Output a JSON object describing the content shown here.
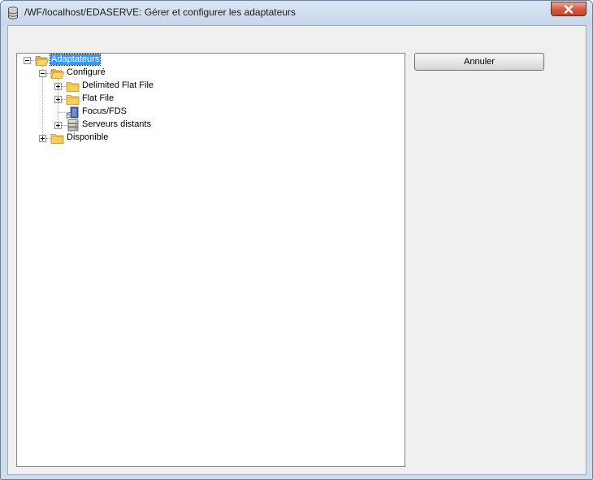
{
  "window": {
    "title": "/WF/localhost/EDASERVE: Gérer et configurer les adaptateurs"
  },
  "buttons": {
    "cancel_label": "Annuler"
  },
  "tree": {
    "root": {
      "label": "Adaptateurs",
      "icon": "folder-open-icon",
      "expanded": true,
      "selected": true
    },
    "nodes": [
      {
        "label": "Configuré",
        "icon": "folder-open-icon",
        "expanded": true
      },
      {
        "label": "Delimited Flat File",
        "icon": "folder-icon",
        "expanded": false
      },
      {
        "label": "Flat File",
        "icon": "folder-icon",
        "expanded": false
      },
      {
        "label": "Focus/FDS",
        "icon": "database-book-icon"
      },
      {
        "label": "Serveurs distants",
        "icon": "server-stack-icon",
        "expanded": false
      },
      {
        "label": "Disponible",
        "icon": "folder-icon",
        "expanded": false
      }
    ]
  },
  "colors": {
    "selection": "#3399ff",
    "folder": "#f2c64a",
    "close_button": "#c9452c"
  }
}
